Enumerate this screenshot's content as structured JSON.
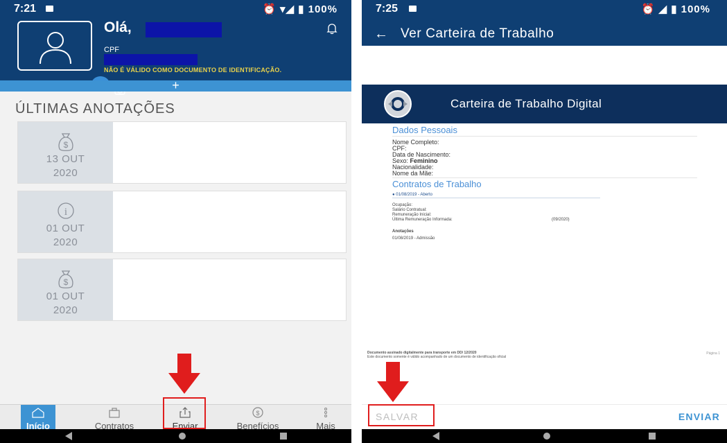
{
  "left": {
    "status": {
      "time": "7:21",
      "battery": "100%"
    },
    "header": {
      "greeting": "Olá,",
      "cpf_label": "CPF",
      "disclaimer": "NÃO É VÁLIDO COMO DOCUMENTO DE IDENTIFICAÇÃO."
    },
    "add_button": "+",
    "section_title": "ÚLTIMAS ANOTAÇÕES",
    "cards": [
      {
        "icon": "money-bag-icon",
        "day": "13 OUT",
        "year": "2020"
      },
      {
        "icon": "info-icon",
        "day": "01 OUT",
        "year": "2020"
      },
      {
        "icon": "money-bag-icon",
        "day": "01 OUT",
        "year": "2020"
      }
    ],
    "nav": [
      {
        "label": "Início",
        "icon": "home-icon",
        "active": true
      },
      {
        "label": "Contratos",
        "icon": "briefcase-icon",
        "active": false
      },
      {
        "label": "Enviar",
        "icon": "share-upload-icon",
        "active": false
      },
      {
        "label": "Benefícios",
        "icon": "dollar-coin-icon",
        "active": false
      },
      {
        "label": "Mais",
        "icon": "more-vertical-icon",
        "active": false
      }
    ]
  },
  "right": {
    "status": {
      "time": "7:25",
      "battery": "100%"
    },
    "title": "Ver Carteira de Trabalho",
    "doc_title": "Carteira de Trabalho Digital",
    "sections": {
      "pessoais": "Dados Pessoais",
      "contratos": "Contratos de Trabalho"
    },
    "fields": {
      "nome": "Nome Completo:",
      "cpf": "CPF:",
      "nascimento": "Data de Nascimento:",
      "sexo_label": "Sexo:",
      "sexo_value": "Feminino",
      "nacionalidade": "Nacionalidade:",
      "mae": "Nome da Mãe:"
    },
    "contract": {
      "item": "01/08/2019 - Aberto",
      "ocupacao": "Ocupação:",
      "salario": "Salário Contratual:",
      "remun_inicial": "Remuneração Inicial:",
      "remun_ultima": "Última Remuneração Informada:",
      "remun_date": "(09/2020)",
      "anotacoes": "Anotações",
      "admissao": "01/08/2019 - Admissão"
    },
    "footer": {
      "line1": "Documento assinado digitalmente para transporte em DD/ 12/2020",
      "line2": "Este documento somente é válido acompanhado de um documento de identificação oficial",
      "page": "Página 1"
    },
    "actions": {
      "save": "SALVAR",
      "send": "ENVIAR"
    }
  },
  "colors": {
    "header": "#0f3f73",
    "accent": "#3d93d3",
    "highlight": "#e01d1d"
  }
}
